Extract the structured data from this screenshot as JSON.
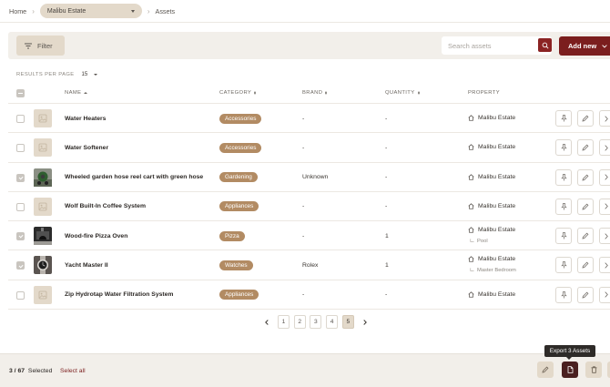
{
  "breadcrumb": {
    "home": "Home",
    "property_select": "Malibu Estate",
    "current": "Assets"
  },
  "toolbar": {
    "filter_label": "Filter",
    "search_placeholder": "Search assets",
    "add_new_label": "Add new"
  },
  "pagination_size": {
    "label": "RESULTS PER PAGE",
    "value": "15"
  },
  "table": {
    "columns": {
      "name": "NAME",
      "category": "CATEGORY",
      "brand": "BRAND",
      "quantity": "QUANTITY",
      "property": "PROPERTY"
    },
    "rows": [
      {
        "name": "Water Heaters",
        "category": "Accessories",
        "brand": "-",
        "quantity": "-",
        "property": "Malibu Estate",
        "sublocation": "",
        "selected": false,
        "thumb": "placeholder"
      },
      {
        "name": "Water Softener",
        "category": "Accessories",
        "brand": "-",
        "quantity": "-",
        "property": "Malibu Estate",
        "sublocation": "",
        "selected": false,
        "thumb": "placeholder"
      },
      {
        "name": "Wheeled garden hose reel cart with green hose",
        "category": "Gardening",
        "brand": "Unknown",
        "quantity": "-",
        "property": "Malibu Estate",
        "sublocation": "",
        "selected": true,
        "thumb": "hose-photo"
      },
      {
        "name": "Wolf Built-In Coffee System",
        "category": "Appliances",
        "brand": "-",
        "quantity": "-",
        "property": "Malibu Estate",
        "sublocation": "",
        "selected": false,
        "thumb": "placeholder"
      },
      {
        "name": "Wood-fire Pizza Oven",
        "category": "Pizza",
        "brand": "-",
        "quantity": "1",
        "property": "Malibu Estate",
        "sublocation": "Pool",
        "selected": true,
        "thumb": "oven-photo"
      },
      {
        "name": "Yacht Master II",
        "category": "Watches",
        "brand": "Rolex",
        "quantity": "1",
        "property": "Malibu Estate",
        "sublocation": "Master Bedroom",
        "selected": true,
        "thumb": "watch-photo"
      },
      {
        "name": "Zip Hydrotap Water Filtration System",
        "category": "Appliances",
        "brand": "-",
        "quantity": "-",
        "property": "Malibu Estate",
        "sublocation": "",
        "selected": false,
        "thumb": "placeholder"
      }
    ]
  },
  "pager": {
    "pages": [
      "1",
      "2",
      "3",
      "4",
      "5"
    ],
    "current": "5"
  },
  "bottom_bar": {
    "selected_count": "3 / 67",
    "selected_label": "Selected",
    "select_all": "Select all",
    "tooltip": "Export 3 Assets"
  },
  "colors": {
    "accent": "#7b1e1e",
    "pill": "#b28b63",
    "tan": "#e3d9ca",
    "toolbar_bg": "#f2efea"
  }
}
